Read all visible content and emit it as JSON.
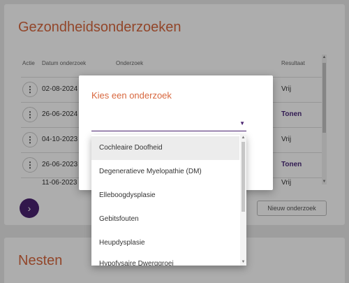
{
  "health": {
    "title": "Gezondheidsonderzoeken",
    "columns": {
      "actie": "Actie",
      "datum": "Datum onderzoek",
      "onderzoek": "Onderzoek",
      "resultaat": "Resultaat"
    },
    "rows": [
      {
        "date": "02-08-2024",
        "result": "Vrij"
      },
      {
        "date": "26-06-2024",
        "result": "Tonen"
      },
      {
        "date": "04-10-2023",
        "result": "Vrij"
      },
      {
        "date": "26-06-2023",
        "result": "Tonen"
      },
      {
        "date": "11-06-2023",
        "result": "Vrij"
      }
    ],
    "new_button": "Nieuw onderzoek",
    "next_icon": "chevron-right-icon",
    "action_icon": "more-vertical-icon"
  },
  "nests": {
    "title": "Nesten"
  },
  "modal": {
    "title": "Kies een onderzoek",
    "select_value": "",
    "options": [
      "Cochleaire Doofheid",
      "Degeneratieve Myelopathie (DM)",
      "Elleboogdysplasie",
      "Gebitsfouten",
      "Heupdysplasie",
      "Hypofysaire Dwerggroei"
    ]
  },
  "colors": {
    "accent": "#d8673e",
    "primary": "#4a2370"
  }
}
